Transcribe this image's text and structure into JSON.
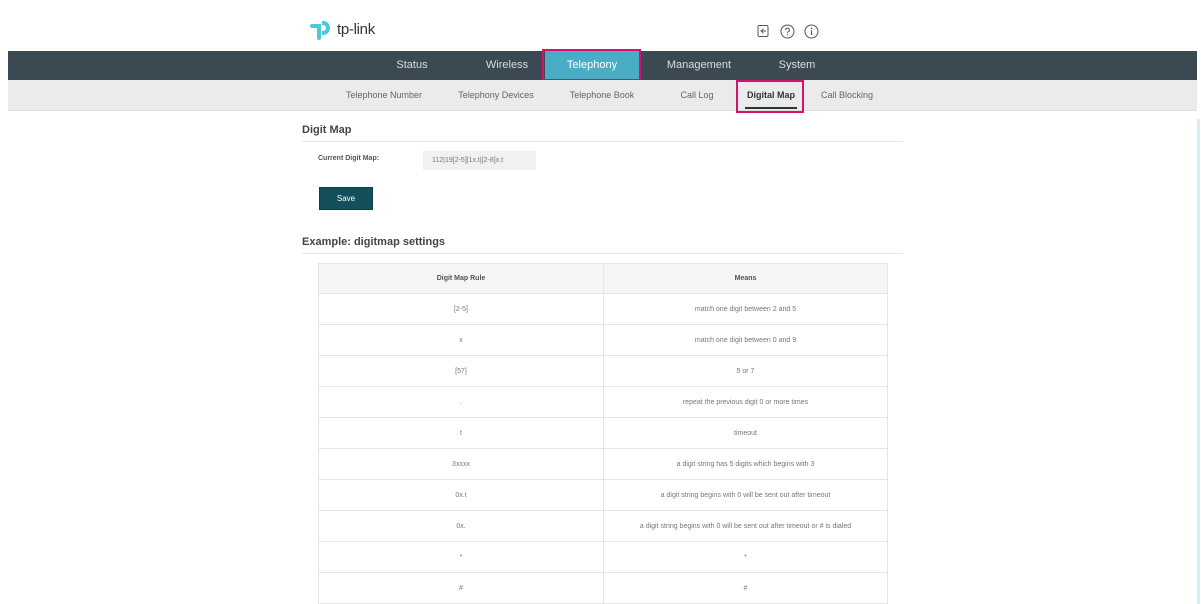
{
  "header": {
    "logo_text": "tp-link",
    "icons": [
      "logout-icon",
      "help-icon",
      "info-icon"
    ]
  },
  "main_nav": {
    "items": [
      {
        "label": "Status"
      },
      {
        "label": "Wireless"
      },
      {
        "label": "Telephony",
        "active": true
      },
      {
        "label": "Management"
      },
      {
        "label": "System"
      }
    ]
  },
  "sub_nav": {
    "items": [
      {
        "label": "Telephone Number"
      },
      {
        "label": "Telephony Devices"
      },
      {
        "label": "Telephone Book"
      },
      {
        "label": "Call Log"
      },
      {
        "label": "Digital Map",
        "active": true
      },
      {
        "label": "Call Blocking"
      }
    ]
  },
  "digit_map": {
    "title": "Digit Map",
    "current_label": "Current Digit Map:",
    "current_value": "112|19[2-5]|1x.t|[2-8]x.t",
    "save_label": "Save"
  },
  "example": {
    "title": "Example: digitmap settings",
    "columns": [
      "Digit Map Rule",
      "Means"
    ],
    "rows": [
      [
        "[2-5]",
        "match one digit between 2 and 5"
      ],
      [
        "x",
        "match one digit between 0 and 9"
      ],
      [
        "[57]",
        "5 or 7"
      ],
      [
        ".",
        "repeat the previous digit 0 or more times"
      ],
      [
        "t",
        "timeout"
      ],
      [
        "3xxxx",
        "a digit string has 5 digits which begins with 3"
      ],
      [
        "0x.t",
        "a digit string begins with 0 will be sent out after timeout"
      ],
      [
        "0x.",
        "a digit string begins with 0 will be sent out after timeout or # is dialed"
      ],
      [
        "*",
        "*"
      ],
      [
        "#",
        "#"
      ]
    ]
  },
  "colors": {
    "nav_bg": "#3b4a52",
    "nav_active": "#4aacc5",
    "highlight": "#d6136b",
    "save_button": "#14505b"
  }
}
